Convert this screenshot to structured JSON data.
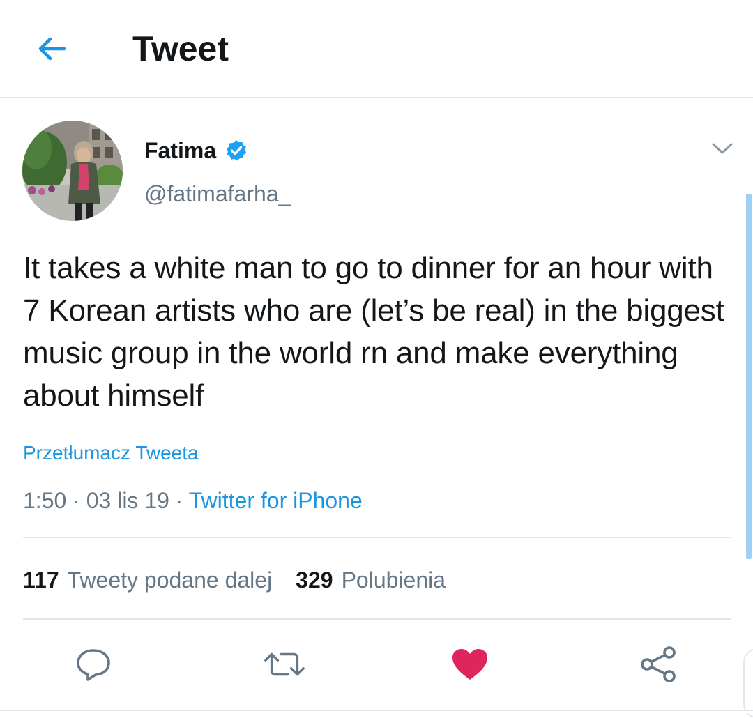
{
  "header": {
    "title": "Tweet",
    "back_icon": "arrow-left-icon"
  },
  "author": {
    "display_name": "Fatima",
    "handle": "@fatimafarha_",
    "verified": true,
    "verified_icon": "verified-badge-icon"
  },
  "tweet": {
    "text": "It takes a white man to go to dinner for an hour with 7 Korean artists who are (let’s be real) in the biggest music group in the world rn and make everything about himself",
    "translate_label": "Przetłumacz Tweeta",
    "time": "1:50",
    "date": "03 lis 19",
    "separator": " · ",
    "source": "Twitter for iPhone"
  },
  "stats": {
    "retweets_count": "117",
    "retweets_label": "Tweety podane dalej",
    "likes_count": "329",
    "likes_label": "Polubienia"
  },
  "actions": [
    {
      "name": "reply",
      "icon": "reply-bubble-icon"
    },
    {
      "name": "retweet",
      "icon": "retweet-icon"
    },
    {
      "name": "like",
      "icon": "heart-icon",
      "active": true
    },
    {
      "name": "share",
      "icon": "share-icon"
    }
  ],
  "colors": {
    "accent": "#1b95e0",
    "muted": "#657786",
    "text": "#14171a",
    "like": "#e0245e",
    "divider": "#e1e8ed"
  }
}
